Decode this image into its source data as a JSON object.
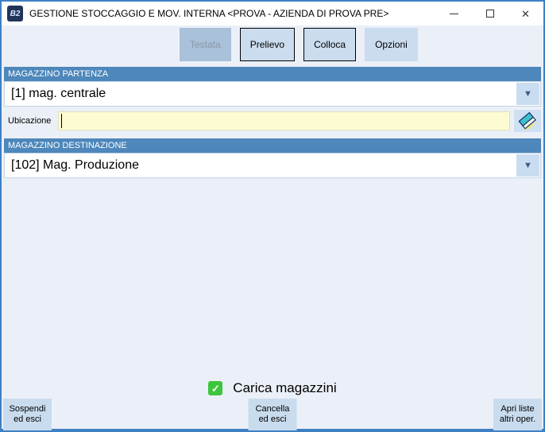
{
  "window": {
    "icon_text": "B2",
    "title": "GESTIONE STOCCAGGIO E MOV. INTERNA <PROVA - AZIENDA DI PROVA PRE>"
  },
  "tabs": [
    {
      "label": "Testata",
      "active": true
    },
    {
      "label": "Prelievo",
      "active": false
    },
    {
      "label": "Colloca",
      "active": false
    },
    {
      "label": "Opzioni",
      "active": false
    }
  ],
  "sections": {
    "partenza": {
      "header": "MAGAZZINO PARTENZA",
      "value": "[1] mag. centrale"
    },
    "destinazione": {
      "header": "MAGAZZINO DESTINAZIONE",
      "value": "[102] Mag. Produzione"
    }
  },
  "fields": {
    "ubicazione": {
      "label": "Ubicazione",
      "value": ""
    }
  },
  "checkbox": {
    "label": "Carica magazzini",
    "checked": true
  },
  "footer": {
    "sospendi": {
      "line1": "Sospendi",
      "line2": "ed esci"
    },
    "cancella": {
      "line1": "Cancella",
      "line2": "ed esci"
    },
    "apri": {
      "line1": "Apri liste",
      "line2": "altri oper."
    }
  },
  "icons": {
    "dropdown_arrow": "▼",
    "check_glyph": "✓",
    "close_glyph": "✕"
  },
  "colors": {
    "window_border": "#3e80c4",
    "section_header": "#4d87bb",
    "tab_active": "#a9c1d9",
    "tab_inactive": "#cadcee",
    "field_yellow": "#fdfbd2",
    "checkbox_green": "#3dc53d",
    "button_blue": "#c9dcee"
  }
}
